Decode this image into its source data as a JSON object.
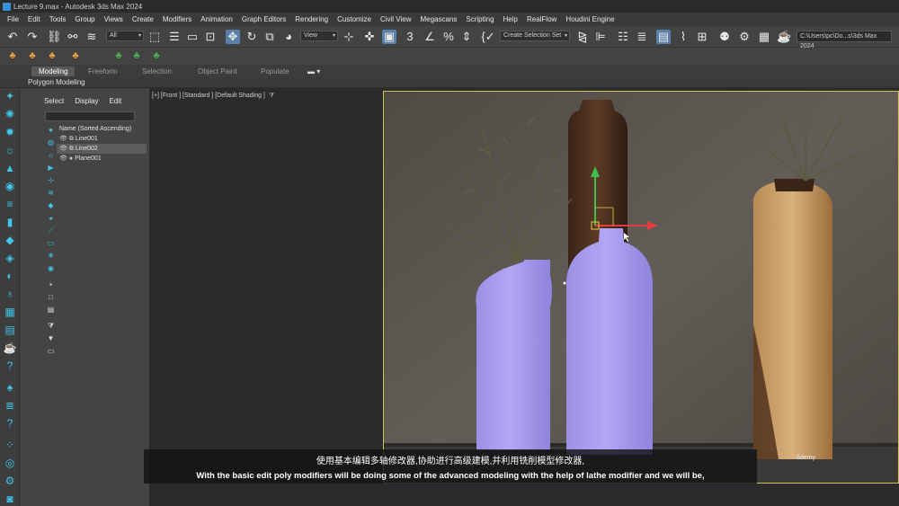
{
  "window": {
    "title": "Lecture 9.max - Autodesk 3ds Max 2024"
  },
  "menu": [
    "File",
    "Edit",
    "Tools",
    "Group",
    "Views",
    "Create",
    "Modifiers",
    "Animation",
    "Graph Editors",
    "Rendering",
    "Customize",
    "Civil View",
    "Megascans",
    "Scripting",
    "Help",
    "RealFlow",
    "Houdini Engine"
  ],
  "toolbar": {
    "selection_filter": "All",
    "coord_system": "View",
    "snap_label": "3",
    "named_selection": "Create Selection Set",
    "project_path": "C:\\Users\\pc\\Do...s\\3ds Max 2024"
  },
  "ribbon": {
    "tabs": [
      "Modeling",
      "Freeform",
      "Selection",
      "Object Paint",
      "Populate"
    ],
    "active_tab": "Modeling",
    "panel_label": "Polygon Modeling"
  },
  "explorer": {
    "tabs": [
      "Select",
      "Display",
      "Edit"
    ],
    "column_header": "Name (Sorted Ascending)",
    "items": [
      {
        "name": "Line001",
        "selected": false
      },
      {
        "name": "Line002",
        "selected": true
      },
      {
        "name": "Plane001",
        "selected": false
      }
    ]
  },
  "viewport": {
    "label": "[+] [Front ] [Standard ] [Default Shading ]",
    "watermark": "ûdemy"
  },
  "subtitles": {
    "chinese": "使用基本编辑多轴修改器,协助进行高级建模,并利用铣削模型修改器,",
    "english": "With the basic edit poly modifiers will be doing some of the advanced modeling with the help of lathe modifier and we will be,"
  },
  "colors": {
    "accent": "#3ec5e8",
    "bottle": "#a99cf0",
    "viewport_frame": "#c9c35a"
  }
}
